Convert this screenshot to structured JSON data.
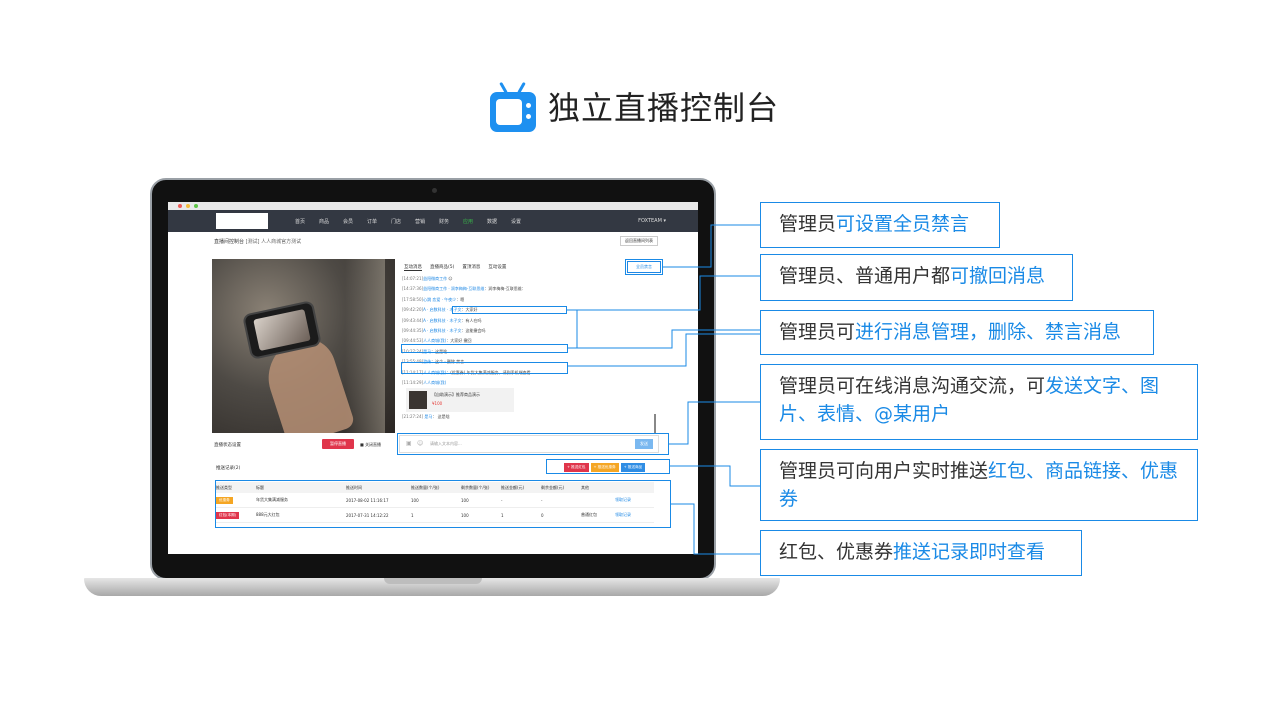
{
  "title": "独立直播控制台",
  "colors": {
    "accent": "#1a8ae6",
    "red": "#e0354b",
    "orange": "#f5a623",
    "blue": "#2f8de4"
  },
  "app": {
    "nav_items": [
      "首页",
      "商品",
      "会员",
      "订单",
      "门店",
      "营销",
      "财务",
      "应用",
      "数据",
      "设置"
    ],
    "nav_active_index": 7,
    "team": "FOXTEAM ▾",
    "page_title": "直播间控制台",
    "page_subtitle": "[测试] 人人商城官方测试",
    "back_button": "返回直播间列表",
    "chat_tabs": [
      "互动消息",
      "直播商品(5)",
      "置顶消息",
      "互动设置"
    ],
    "ban_all": "全员禁言",
    "chat_lines": [
      {
        "time": "[14:07:21]",
        "name": "益阳微商工作",
        "text": "",
        "red": false
      },
      {
        "time": "[14:37:36]",
        "name": "益阳微商工作 · 润李梅梅-互联思维",
        "text": "润李梅梅-互联思维：",
        "red": false
      },
      {
        "time": "[17:58:50]",
        "name": "心跳 恋爱 · 午夜少",
        "text": "嗯",
        "red": false
      },
      {
        "time": "[09:42:20]",
        "name": "A · 启数科技 · 木子文",
        "text": "大家好",
        "red": false
      },
      {
        "time": "[09:43:44]",
        "name": "A · 启数科技 · 木子文",
        "text": "有人在吗",
        "red": false
      },
      {
        "time": "[09:44:35]",
        "name": "A · 启数科技 · 木子文",
        "text": "这能撤会吗",
        "red": false
      },
      {
        "time": "[09:44:53]",
        "name": "人人商城(我)",
        "text": "大家好 撤回",
        "red": false
      },
      {
        "time": "[10:27:24]",
        "name": "是马",
        "text": "这是啥",
        "red": false
      },
      {
        "time": "[13:55:49]",
        "name": "游伟",
        "text": "这个 · 删除 禁言",
        "red": false
      },
      {
        "time": "[11:14:17]",
        "name": "人人商城(我)",
        "text": "(优惠券) 年货大集满减服务，请到手机端查看",
        "red": false
      },
      {
        "time": "[11:14:29]",
        "name": "人人商城(我)",
        "text": "",
        "red": false
      }
    ],
    "product_card": {
      "name": "【自助演示】推荐商品演示",
      "price": "¥100"
    },
    "last_chat": {
      "time": "[21:27:24]",
      "name": "是马",
      "text": "这是啥"
    },
    "live_status_label": "直播状态设置",
    "live_button": "暂停直播",
    "end_live": "关闭直播",
    "input_placeholder": "请输入文本内容...",
    "send_button": "发送",
    "record_title": "推送记录(2)",
    "push_buttons": [
      {
        "label": "+ 推送红包",
        "color": "#e0354b"
      },
      {
        "label": "+ 推送优惠券",
        "color": "#f5a623"
      },
      {
        "label": "+ 推送商品",
        "color": "#2f8de4"
      }
    ],
    "table_headers": [
      "推送类型",
      "标题",
      "推送时间",
      "推送数量(个/张)",
      "剩余数量(个/张)",
      "推送金额(元)",
      "剩余金额(元)",
      "其他",
      ""
    ],
    "table_rows": [
      {
        "type": "优惠券",
        "type_color": "#f5a623",
        "title": "年货大集满减服务",
        "time": "2017-08-02 11:16:17",
        "push_qty": "100",
        "left_qty": "100",
        "push_amt": "-",
        "left_amt": "-",
        "other": "",
        "link": "领取记录"
      },
      {
        "type": "红包(本期)",
        "type_color": "#e0354b",
        "title": "888元大红包",
        "time": "2017-07-31 14:12:22",
        "push_qty": "1",
        "left_qty": "100",
        "push_amt": "1",
        "left_amt": "0",
        "other": "普通红包",
        "link": "领取记录"
      }
    ]
  },
  "callouts": [
    {
      "pre": "管理员",
      "hl": "可设置全员禁言",
      "post": ""
    },
    {
      "pre": "管理员、普通用户都",
      "hl": "可撤回消息",
      "post": ""
    },
    {
      "pre": "管理员可",
      "hl": "进行消息管理，删除、禁言消息",
      "post": ""
    },
    {
      "pre": "管理员可在线消息沟通交流，可",
      "hl": "发送文字、图片、表情、@某用户",
      "post": ""
    },
    {
      "pre": "管理员可向用户实时推送",
      "hl": "红包、商品链接、优惠券",
      "post": ""
    },
    {
      "pre": "红包、优惠券",
      "hl": "推送记录即时查看",
      "post": ""
    }
  ]
}
